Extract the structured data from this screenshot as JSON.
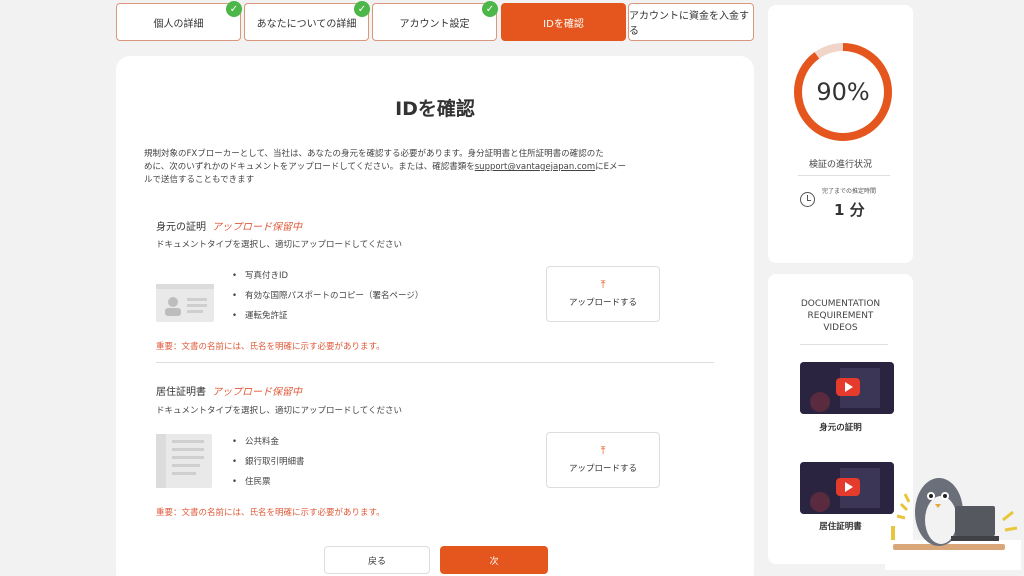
{
  "steps": [
    {
      "label": "個人の詳細",
      "done": true
    },
    {
      "label": "あなたについての詳細",
      "done": true
    },
    {
      "label": "アカウント設定",
      "done": true
    },
    {
      "label": "IDを確認",
      "active": true
    },
    {
      "label": "アカウントに資金を入金する"
    }
  ],
  "main": {
    "title": "IDを確認",
    "intro_line1": "規制対象のFXブローカーとして、当社は、あなたの身元を確認する必要があります。身分証明書と住所証明書の確認のた",
    "intro_line2_pre": "めに、次のいずれかのドキュメントをアップロードしてください。または、確認書類を",
    "intro_email": "support@vantagejapan.com",
    "intro_line2_post": "にEメー",
    "intro_line3": "ルで送信することもできます",
    "identity": {
      "title": "身元の証明",
      "status": "アップロード保留中",
      "subtitle": "ドキュメントタイプを選択し、適切にアップロードしてください",
      "docs": [
        "写真付きID",
        "有効な国際パスポートのコピー（署名ページ）",
        "運転免許証"
      ],
      "upload_label": "アップロードする",
      "note": "重要：文書の名前には、氏名を明確に示す必要があります。"
    },
    "residence": {
      "title": "居住証明書",
      "status": "アップロード保留中",
      "subtitle": "ドキュメントタイプを選択し、適切にアップロードしてください",
      "docs": [
        "公共料金",
        "銀行取引明細書",
        "住民票"
      ],
      "upload_label": "アップロードする",
      "note": "重要：文書の名前には、氏名を明確に示す必要があります。"
    },
    "back_label": "戻る",
    "next_label": "次"
  },
  "progress": {
    "percent": 90,
    "percent_text": "90%",
    "label": "検証の進行状況",
    "time_label": "完了までの推定時間",
    "time_value": "1 分"
  },
  "videos": {
    "title_line1": "DOCUMENTATION",
    "title_line2": "REQUIREMENT",
    "title_line3": "VIDEOS",
    "items": [
      {
        "label": "身元の証明"
      },
      {
        "label": "居住証明書"
      }
    ]
  },
  "colors": {
    "accent": "#e4561e",
    "check": "#4cb748",
    "pending": "#e05a3a"
  },
  "icons": [
    "check-icon",
    "upload-arrow-icon",
    "clock-icon",
    "play-icon"
  ]
}
